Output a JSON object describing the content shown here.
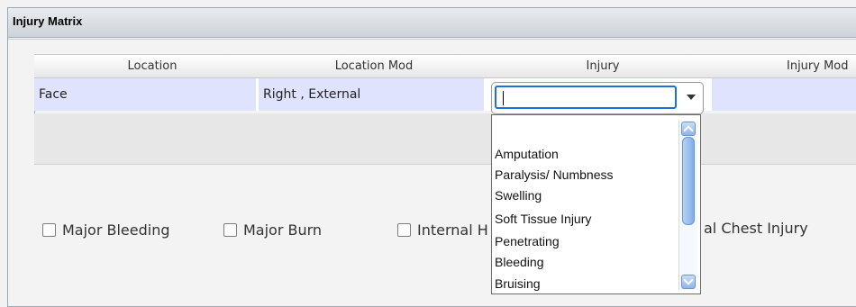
{
  "panel": {
    "title": "Injury Matrix"
  },
  "table": {
    "columns": [
      "Location",
      "Location Mod",
      "Injury",
      "Injury Mod"
    ],
    "row": {
      "location": "Face",
      "location_mod": "Right , External",
      "injury": ""
    }
  },
  "dropdown": {
    "options": [
      "Amputation",
      "Paralysis/ Numbness",
      "Swelling",
      "Soft Tissue Injury",
      "Penetrating",
      "Bleeding",
      "Bruising"
    ]
  },
  "checkboxes": {
    "items": [
      "Major Bleeding",
      "Major Burn",
      "Internal H"
    ],
    "partial_label": "al Chest Injury"
  },
  "icons": {
    "combo_arrow": "chevron-down-icon",
    "scroll_up": "scroll-up-icon",
    "scroll_down": "scroll-down-icon",
    "checkbox": "checkbox-icon"
  }
}
